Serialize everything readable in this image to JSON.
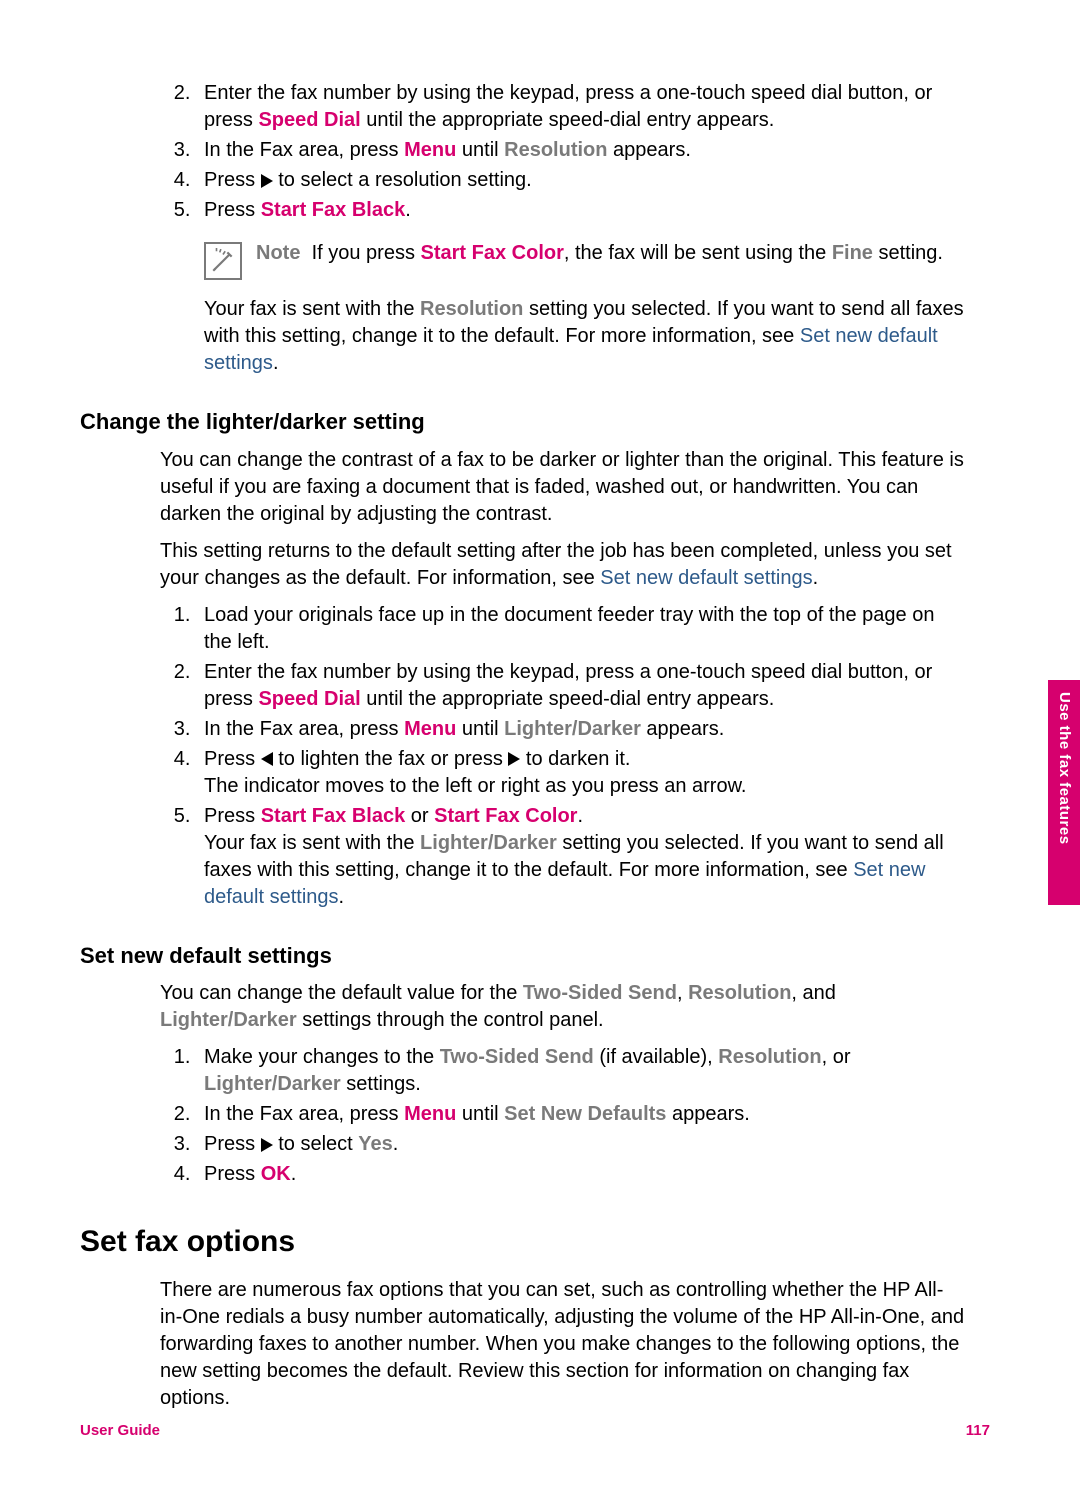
{
  "top_steps": {
    "s2_a": "Enter the fax number by using the keypad, press a one-touch speed dial button, or press ",
    "s2_b": "Speed Dial",
    "s2_c": " until the appropriate speed-dial entry appears.",
    "s3_a": "In the Fax area, press ",
    "s3_b": "Menu",
    "s3_c": " until ",
    "s3_d": "Resolution",
    "s3_e": " appears.",
    "s4_a": "Press ",
    "s4_b": " to select a resolution setting.",
    "s5_a": "Press ",
    "s5_b": "Start Fax Black",
    "s5_c": "."
  },
  "note": {
    "label": "Note",
    "a": "If you press ",
    "b": "Start Fax Color",
    "c": ", the fax will be sent using the ",
    "d": "Fine",
    "e": " setting."
  },
  "follow1": {
    "a": "Your fax is sent with the ",
    "b": "Resolution",
    "c": " setting you selected. If you want to send all faxes with this setting, change it to the default. For more information, see ",
    "d": "Set new default settings",
    "e": "."
  },
  "h_lighter": "Change the lighter/darker setting",
  "lighter_p1": "You can change the contrast of a fax to be darker or lighter than the original. This feature is useful if you are faxing a document that is faded, washed out, or handwritten. You can darken the original by adjusting the contrast.",
  "lighter_p2_a": "This setting returns to the default setting after the job has been completed, unless you set your changes as the default. For information, see ",
  "lighter_p2_b": "Set new default settings",
  "lighter_p2_c": ".",
  "lighter_steps": {
    "s1": "Load your originals face up in the document feeder tray with the top of the page on the left.",
    "s2_a": "Enter the fax number by using the keypad, press a one-touch speed dial button, or press ",
    "s2_b": "Speed Dial",
    "s2_c": " until the appropriate speed-dial entry appears.",
    "s3_a": "In the Fax area, press ",
    "s3_b": "Menu",
    "s3_c": " until ",
    "s3_d": "Lighter/Darker",
    "s3_e": " appears.",
    "s4_a": "Press ",
    "s4_b": " to lighten the fax or press ",
    "s4_c": " to darken it.",
    "s4_line2": "The indicator moves to the left or right as you press an arrow.",
    "s5_a": "Press ",
    "s5_b": "Start Fax Black",
    "s5_c": " or ",
    "s5_d": "Start Fax Color",
    "s5_e": ".",
    "s5_f_a": "Your fax is sent with the ",
    "s5_f_b": "Lighter/Darker",
    "s5_f_c": " setting you selected. If you want to send all faxes with this setting, change it to the default. For more information, see ",
    "s5_f_d": "Set new default settings",
    "s5_f_e": "."
  },
  "h_defaults": "Set new default settings",
  "defaults_p1_a": "You can change the default value for the ",
  "defaults_p1_b": "Two-Sided Send",
  "defaults_p1_c": ", ",
  "defaults_p1_d": "Resolution",
  "defaults_p1_e": ", and ",
  "defaults_p1_f": "Lighter/Darker",
  "defaults_p1_g": " settings through the control panel.",
  "defaults_steps": {
    "s1_a": "Make your changes to the ",
    "s1_b": "Two-Sided Send",
    "s1_c": " (if available), ",
    "s1_d": "Resolution",
    "s1_e": ", or ",
    "s1_f": "Lighter/Darker",
    "s1_g": " settings.",
    "s2_a": "In the Fax area, press ",
    "s2_b": "Menu",
    "s2_c": " until ",
    "s2_d": "Set New Defaults",
    "s2_e": " appears.",
    "s3_a": "Press ",
    "s3_b": " to select ",
    "s3_c": "Yes",
    "s3_d": ".",
    "s4_a": "Press ",
    "s4_b": "OK",
    "s4_c": "."
  },
  "h_options": "Set fax options",
  "options_p1": "There are numerous fax options that you can set, such as controlling whether the HP All-in-One redials a busy number automatically, adjusting the volume of the HP All-in-One, and forwarding faxes to another number. When you make changes to the following options, the new setting becomes the default. Review this section for information on changing fax options.",
  "side_tab": "Use the fax features",
  "footer_left": "User Guide",
  "footer_right": "117"
}
